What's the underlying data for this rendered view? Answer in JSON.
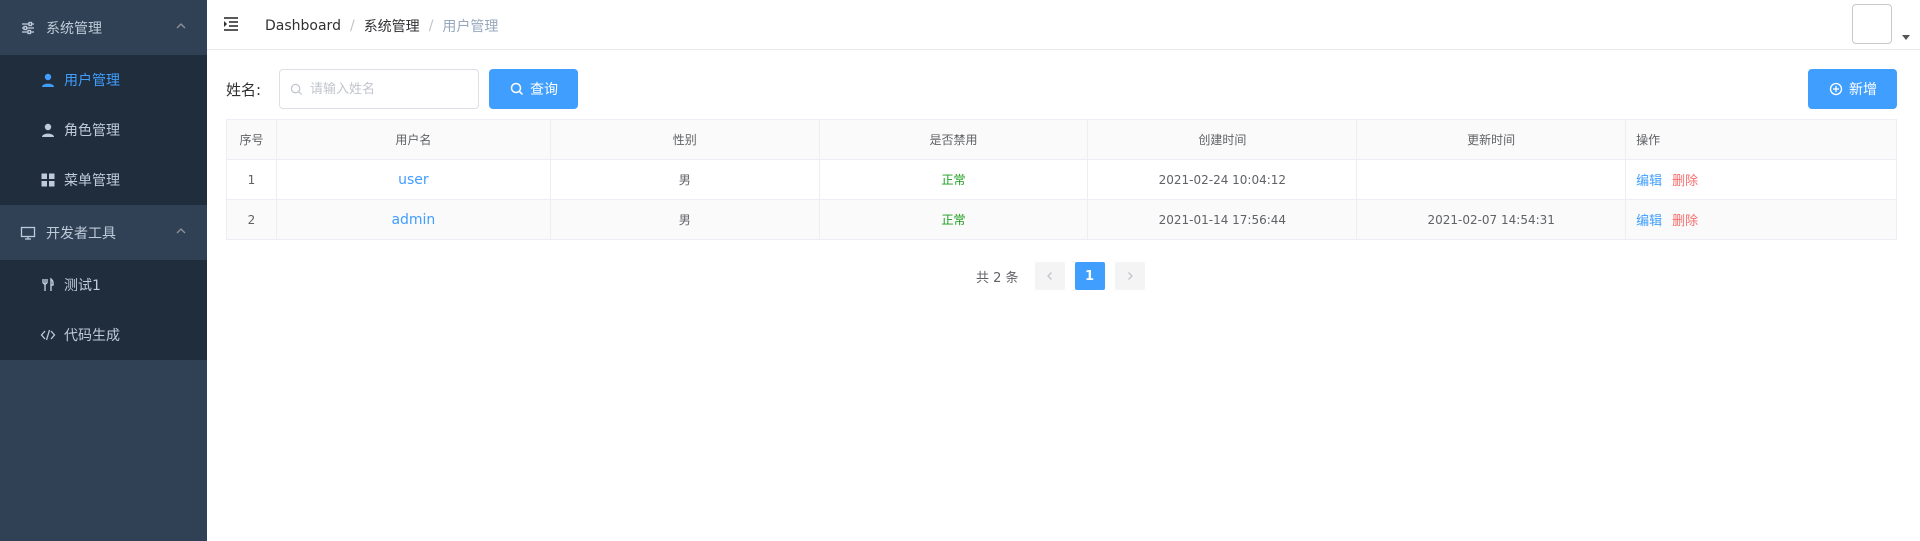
{
  "sidebar": {
    "groups": [
      {
        "title": "系统管理",
        "items": [
          {
            "label": "用户管理",
            "active": true
          },
          {
            "label": "角色管理"
          },
          {
            "label": "菜单管理"
          }
        ]
      },
      {
        "title": "开发者工具",
        "items": [
          {
            "label": "测试1"
          },
          {
            "label": "代码生成"
          }
        ]
      }
    ]
  },
  "breadcrumb": [
    "Dashboard",
    "系统管理",
    "用户管理"
  ],
  "search": {
    "label": "姓名:",
    "placeholder": "请输入姓名",
    "value": "",
    "query_button": "查询"
  },
  "add_button": "新增",
  "table": {
    "columns": [
      "序号",
      "用户名",
      "性别",
      "是否禁用",
      "创建时间",
      "更新时间",
      "操作"
    ],
    "rows": [
      {
        "index": "1",
        "username": "user",
        "gender": "男",
        "status": "正常",
        "created": "2021-02-24 10:04:12",
        "updated": "",
        "edit": "编辑",
        "delete": "删除"
      },
      {
        "index": "2",
        "username": "admin",
        "gender": "男",
        "status": "正常",
        "created": "2021-01-14 17:56:44",
        "updated": "2021-02-07 14:54:31",
        "edit": "编辑",
        "delete": "删除"
      }
    ]
  },
  "pagination": {
    "total_text": "共 2 条",
    "current_page": "1"
  },
  "colors": {
    "sidebar_bg": "#304156",
    "submenu_bg": "#1f2d3d",
    "primary": "#409eff",
    "danger": "#f56c6c",
    "success": "#1a9c1a"
  }
}
